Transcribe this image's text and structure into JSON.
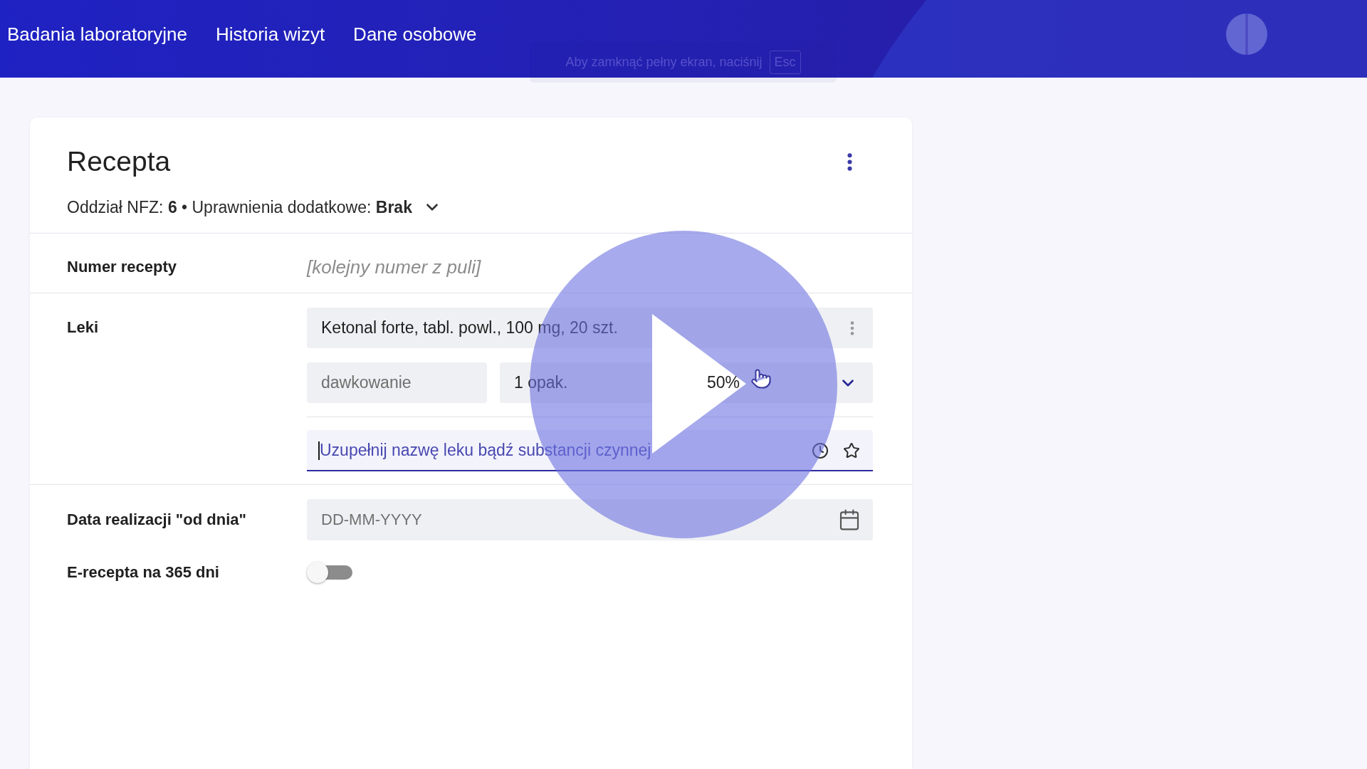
{
  "header": {
    "nav": [
      {
        "label": "Badania laboratoryjne"
      },
      {
        "label": "Historia wizyt"
      },
      {
        "label": "Dane osobowe"
      }
    ]
  },
  "fullscreen_notice": {
    "text": "Aby zamknąć pełny ekran, naciśnij",
    "key": "Esc"
  },
  "card": {
    "title": "Recepta",
    "subtitle": "Oddział NFZ: **6** • Uprawnienia dodatkowe: **Brak**",
    "rows": [
      {
        "kind": "text",
        "label": "Numer recepty",
        "value": "[kolejny numer z puli]"
      },
      {
        "kind": "medicines",
        "label": "Leki",
        "items": [
          {
            "name": "Ketonal forte, tabl. powl., 100 mg, 20 szt.",
            "dosage": {
              "placeholder": "dawkowanie"
            },
            "quantity": {
              "value": "1 opak."
            },
            "refund": {
              "value": "50%"
            }
          }
        ],
        "search": {
          "placeholder": "Uzupełnij nazwę leku bądź substancji czynnej",
          "focused": true
        }
      },
      {
        "kind": "date",
        "label": "Data realizacji \"od dnia\"",
        "placeholder": "DD-MM-YYYY"
      },
      {
        "kind": "toggle",
        "label": "E-recepta na 365 dni",
        "on": false
      }
    ]
  },
  "video": {
    "paused": true
  }
}
